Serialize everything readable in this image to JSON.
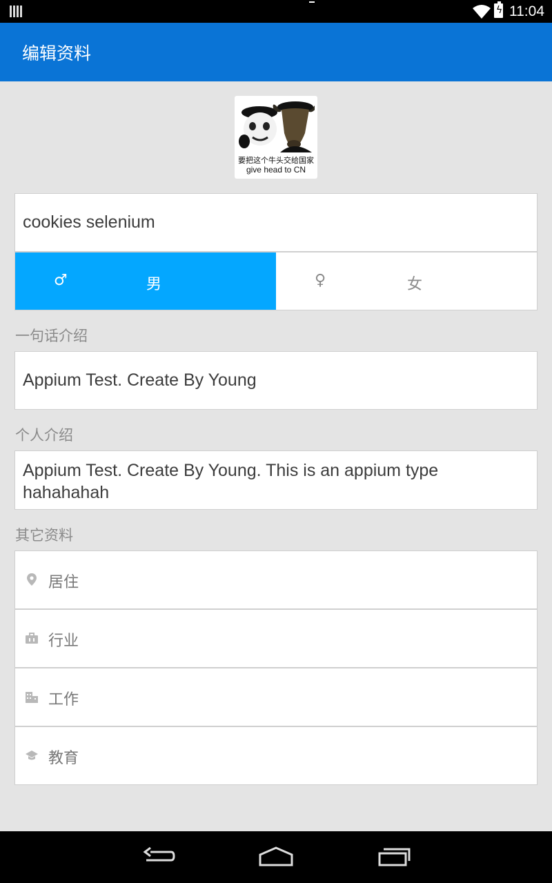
{
  "status_bar": {
    "time": "11:04"
  },
  "app_bar": {
    "title": "编辑资料"
  },
  "avatar": {
    "caption_cn": "要把这个牛头交给国家",
    "caption_en": "give head to CN"
  },
  "name_field": {
    "value": "cookies selenium"
  },
  "gender": {
    "selected": "male",
    "male_symbol": "♂",
    "male_label": "男",
    "female_symbol": "♀",
    "female_label": "女"
  },
  "headline": {
    "label": "一句话介绍",
    "value": "Appium Test. Create By Young"
  },
  "bio": {
    "label": "个人介绍",
    "value": "Appium Test. Create By Young. This is an appium type hahahahah"
  },
  "other": {
    "label": "其它资料",
    "items": [
      {
        "icon": "location-pin-icon",
        "label": "居住"
      },
      {
        "icon": "briefcase-icon",
        "label": "行业"
      },
      {
        "icon": "building-icon",
        "label": "工作"
      },
      {
        "icon": "graduation-cap-icon",
        "label": "教育"
      }
    ]
  },
  "colors": {
    "app_bar": "#0a74d6",
    "selected_gender": "#04a7ff",
    "background": "#e4e4e4"
  }
}
